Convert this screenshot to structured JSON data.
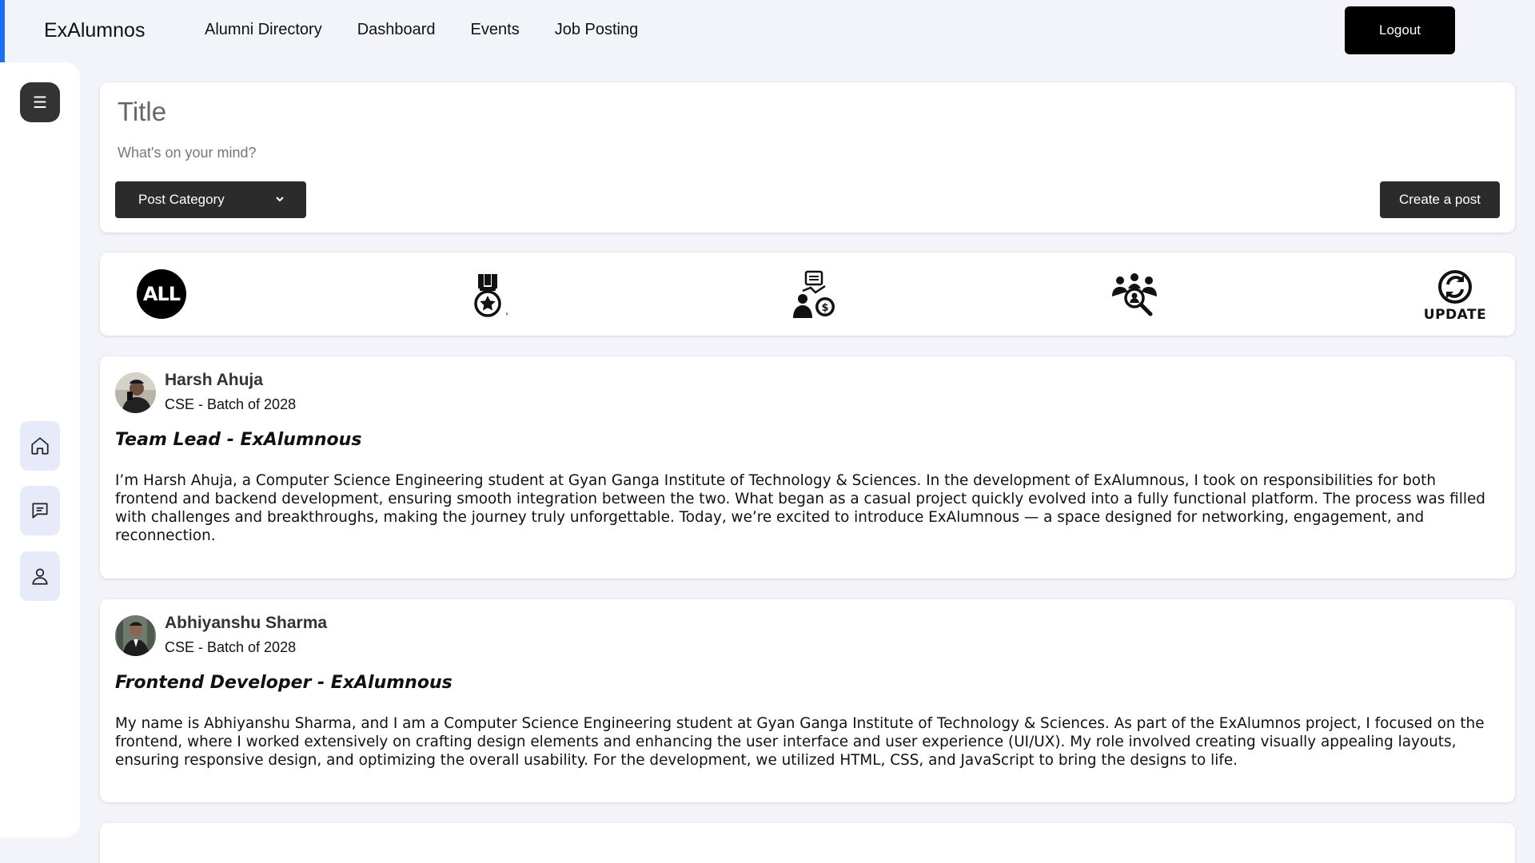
{
  "header": {
    "brand": "ExAlumnos",
    "nav": [
      "Alumni Directory",
      "Dashboard",
      "Events",
      "Job Posting"
    ],
    "logout_label": "Logout",
    "accent_color": "#1e6ff5"
  },
  "sidebar": {
    "menu_glyph": "☰",
    "icons": [
      "home-icon",
      "chat-icon",
      "user-icon"
    ]
  },
  "composer": {
    "title_placeholder": "Title",
    "body_placeholder": "What's on your mind?",
    "category_label": "Post Category",
    "create_label": "Create a post"
  },
  "filters": {
    "all_label": "ALL",
    "achievement_mark": ",",
    "update_label": "UPDATE",
    "icons": [
      "all-icon",
      "medal-icon",
      "funding-icon",
      "team-search-icon",
      "update-icon"
    ]
  },
  "posts": [
    {
      "author": "Harsh Ahuja",
      "batch": "CSE - Batch of 2028",
      "title": "Team Lead - ExAlumnous",
      "body": "I’m Harsh Ahuja, a Computer Science Engineering student at Gyan Ganga Institute of Technology & Sciences. In the development of ExAlumnous, I took on responsibilities for both frontend and backend development, ensuring smooth integration between the two. What began as a casual project quickly evolved into a fully functional platform. The process was filled with challenges and breakthroughs, making the journey truly unforgettable. Today, we’re excited to introduce ExAlumnous — a space designed for networking, engagement, and reconnection."
    },
    {
      "author": "Abhiyanshu Sharma",
      "batch": "CSE - Batch of 2028",
      "title": "Frontend Developer - ExAlumnous",
      "body": "My name is Abhiyanshu Sharma, and I am a Computer Science Engineering student at Gyan Ganga Institute of Technology & Sciences. As part of the ExAlumnos project, I focused on the frontend, where I worked extensively on crafting design elements and enhancing the user interface and user experience (UI/UX). My role involved creating visually appealing layouts, ensuring responsive design, and optimizing the overall usability. For the development, we utilized HTML, CSS, and JavaScript to bring the designs to life."
    }
  ]
}
